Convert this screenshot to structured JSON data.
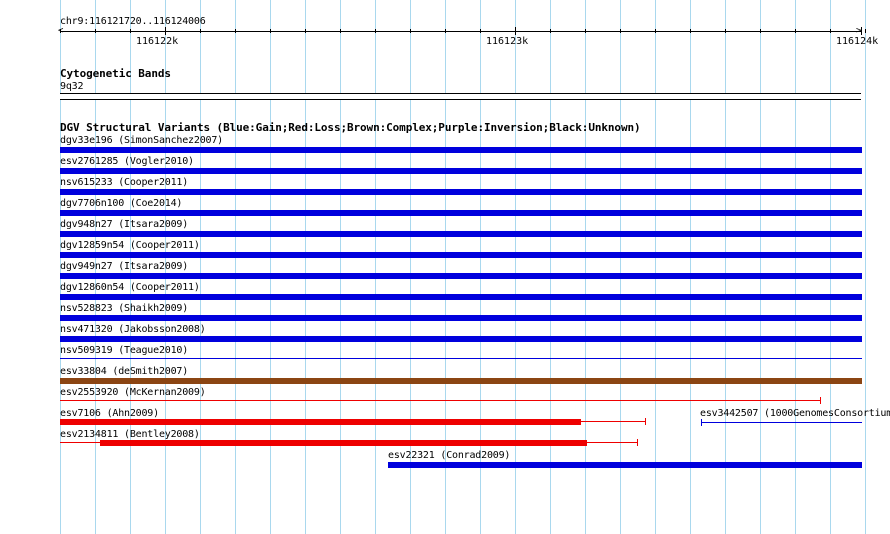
{
  "region_label": "chr9:116121720..116124006",
  "ruler": {
    "major_labels": [
      "116122k",
      "116123k",
      "116124k"
    ]
  },
  "cytoband": {
    "title": "Cytogenetic Bands",
    "band_name": "9q32"
  },
  "dgv": {
    "title": "DGV Structural Variants (Blue:Gain;Red:Loss;Brown:Complex;Purple:Inversion;Black:Unknown)",
    "colors": {
      "gain": "#0000dd",
      "loss": "#ee0000",
      "complex": "#8b4513"
    },
    "features": [
      {
        "label": "dgv33e196 (SimonSanchez2007)",
        "type": "gain"
      },
      {
        "label": "esv2761285 (Vogler2010)",
        "type": "gain"
      },
      {
        "label": "nsv615233 (Cooper2011)",
        "type": "gain"
      },
      {
        "label": "dgv7706n100 (Coe2014)",
        "type": "gain"
      },
      {
        "label": "dgv948n27 (Itsara2009)",
        "type": "gain"
      },
      {
        "label": "dgv12859n54 (Cooper2011)",
        "type": "gain"
      },
      {
        "label": "dgv949n27 (Itsara2009)",
        "type": "gain"
      },
      {
        "label": "dgv12860n54 (Cooper2011)",
        "type": "gain"
      },
      {
        "label": "nsv528823 (Shaikh2009)",
        "type": "gain"
      },
      {
        "label": "nsv471320 (Jakobsson2008)",
        "type": "gain"
      },
      {
        "label": "nsv509319 (Teague2010)",
        "type": "gain"
      },
      {
        "label": "esv33804 (deSmith2007)",
        "type": "complex"
      },
      {
        "label": "esv2553920 (McKernan2009)",
        "type": "loss"
      },
      {
        "label": "esv7106 (Ahn2009)",
        "type": "loss"
      },
      {
        "label": "esv3442507 (1000GenomesConsortium",
        "type": "gain"
      },
      {
        "label": "esv2134811 (Bentley2008)",
        "type": "loss"
      },
      {
        "label": "esv22321 (Conrad2009)",
        "type": "gain"
      }
    ]
  }
}
